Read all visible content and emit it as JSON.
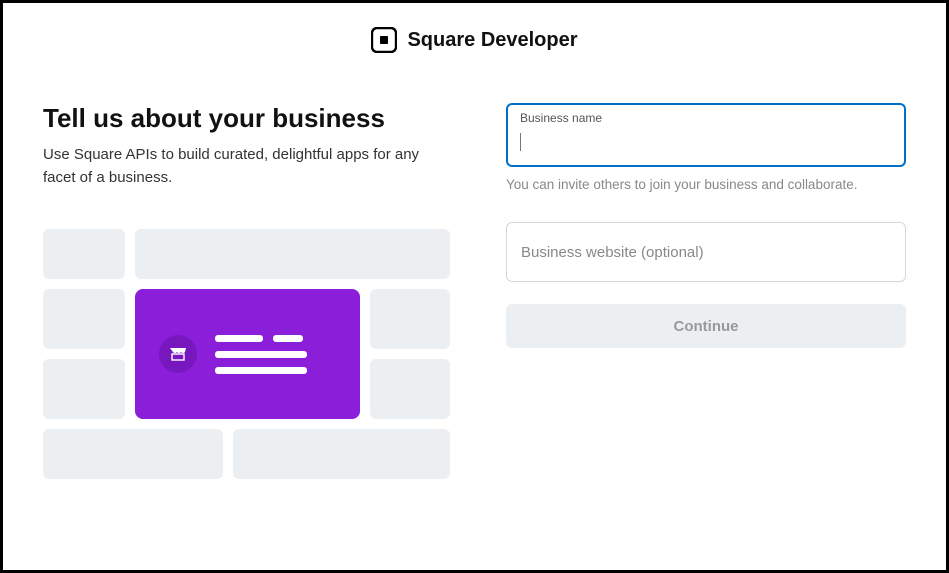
{
  "header": {
    "brand": "Square Developer"
  },
  "left": {
    "heading": "Tell us about your business",
    "subheading": "Use Square APIs to build curated, delightful apps for any facet of a business."
  },
  "form": {
    "business_name": {
      "label": "Business name",
      "value": ""
    },
    "helper": "You can invite others to join your business and collaborate.",
    "website": {
      "placeholder": "Business website (optional)",
      "value": ""
    },
    "continue_label": "Continue"
  }
}
